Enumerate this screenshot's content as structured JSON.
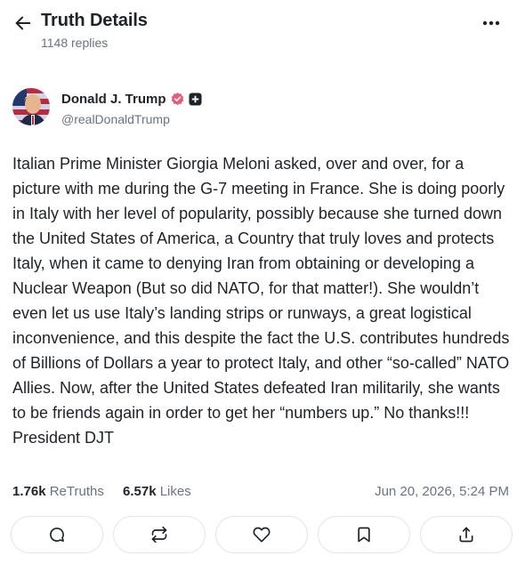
{
  "header": {
    "title": "Truth Details",
    "replies": "1148 replies"
  },
  "author": {
    "name": "Donald J. Trump",
    "handle": "@realDonaldTrump"
  },
  "post": {
    "text": "Italian Prime Minister Giorgia Meloni asked, over and over, for a picture with me during the G-7 meeting in France. She is doing poorly in Italy with her level of popularity, possibly because she turned down the United States of America, a Country that truly loves and protects Italy, when it came to denying Iran from obtaining or developing a Nuclear Weapon (But so did NATO, for that matter!). She wouldn’t even let us use Italy’s landing strips or runways, a great logistical inconvenience, and this despite the fact the U.S. contributes hundreds of Billions of Dollars a year to protect Italy, and other “so-called” NATO Allies. Now, after the United States defeated Iran militarily, she wants to be friends again in order to get her “numbers up.” No thanks!!! President DJT"
  },
  "stats": {
    "retruths_count": "1.76k",
    "retruths_label": "ReTruths",
    "likes_count": "6.57k",
    "likes_label": "Likes",
    "timestamp": "Jun 20, 2026, 5:24 PM"
  },
  "actions": [
    "reply-icon",
    "retruth-icon",
    "like-icon",
    "bookmark-icon",
    "share-icon"
  ],
  "colors": {
    "text": "#1f2328",
    "muted": "#6b7280",
    "verified": "#e85a7a",
    "border": "#e3e5e8"
  }
}
